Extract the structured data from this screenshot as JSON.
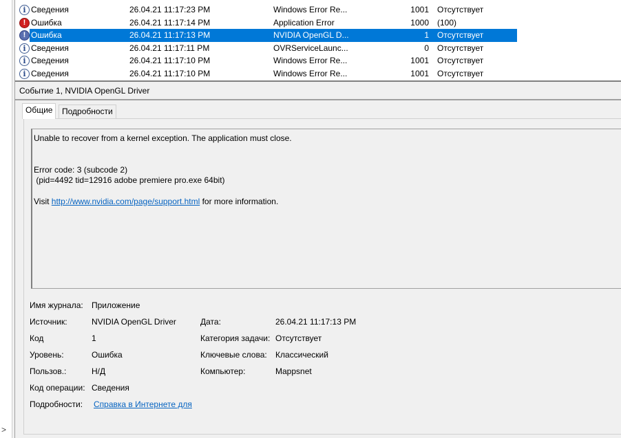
{
  "events": [
    {
      "level": "Сведения",
      "type": "info",
      "date": "26.04.21 11:17:23 PM",
      "source": "Windows Error Re...",
      "code": "1001",
      "category": "Отсутствует"
    },
    {
      "level": "Ошибка",
      "type": "error",
      "date": "26.04.21 11:17:14 PM",
      "source": "Application Error",
      "code": "1000",
      "category": "(100)"
    },
    {
      "level": "Ошибка",
      "type": "error",
      "date": "26.04.21 11:17:13 PM",
      "source": "NVIDIA OpenGL D...",
      "code": "1",
      "category": "Отсутствует",
      "selected": true
    },
    {
      "level": "Сведения",
      "type": "info",
      "date": "26.04.21 11:17:11 PM",
      "source": "OVRServiceLaunc...",
      "code": "0",
      "category": "Отсутствует"
    },
    {
      "level": "Сведения",
      "type": "info",
      "date": "26.04.21 11:17:10 PM",
      "source": "Windows Error Re...",
      "code": "1001",
      "category": "Отсутствует"
    },
    {
      "level": "Сведения",
      "type": "info",
      "date": "26.04.21 11:17:10 PM",
      "source": "Windows Error Re...",
      "code": "1001",
      "category": "Отсутствует"
    }
  ],
  "detail": {
    "title": "Событие 1, NVIDIA OpenGL Driver",
    "tabs": [
      "Общие",
      "Подробности"
    ],
    "message_line1": "Unable to recover from a kernel exception. The application must close.",
    "message_line2": "Error code: 3 (subcode 2)",
    "message_line3": " (pid=4492 tid=12916 adobe premiere pro.exe 64bit)",
    "message_visit": "Visit ",
    "message_link": "http://www.nvidia.com/page/support.html",
    "message_after": " for more information.",
    "fields": {
      "journal_label": "Имя журнала:",
      "journal": "Приложение",
      "source_label": "Источник:",
      "source": "NVIDIA OpenGL Driver",
      "date_label": "Дата:",
      "date": "26.04.21 11:17:13 PM",
      "code_label": "Код",
      "code": "1",
      "task_label": "Категория задачи:",
      "task": "Отсутствует",
      "level_label": "Уровень:",
      "level": "Ошибка",
      "keywords_label": "Ключевые слова:",
      "keywords": "Классический",
      "user_label": "Пользов.:",
      "user": "Н/Д",
      "computer_label": "Компьютер:",
      "computer": "Mappsnet",
      "opcode_label": "Код операции:",
      "opcode": "Сведения",
      "more_label": "Подробности:",
      "more_link": "Справка в Интернете для "
    }
  }
}
